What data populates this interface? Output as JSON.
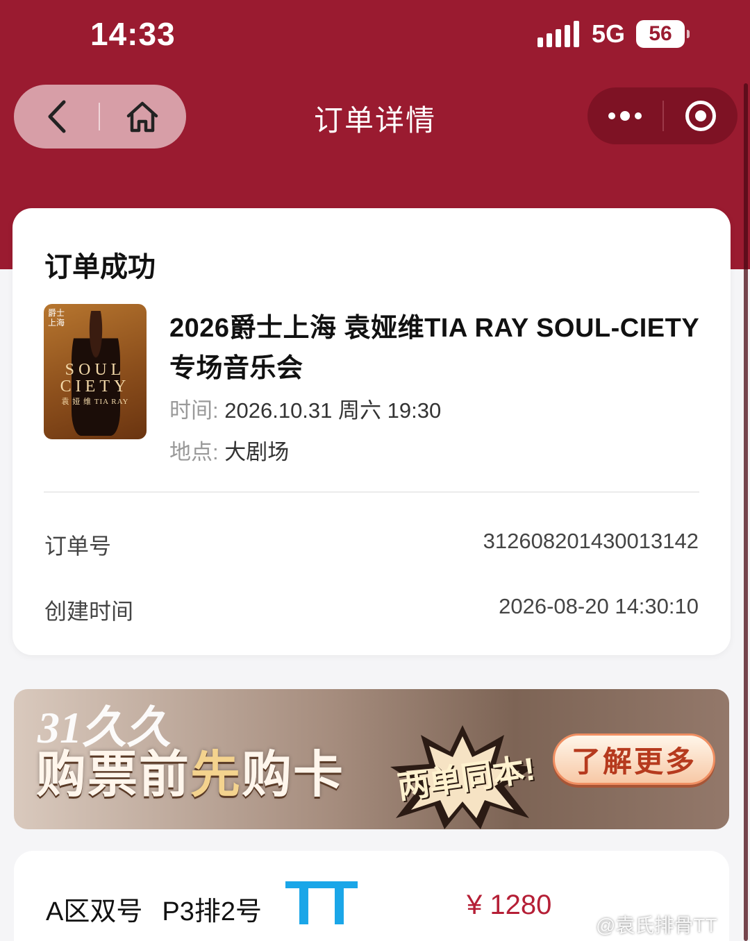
{
  "status_bar": {
    "time": "14:33",
    "network": "5G",
    "battery": "56"
  },
  "nav": {
    "title": "订单详情"
  },
  "order": {
    "status": "订单成功",
    "event_name": "2026爵士上海 袁娅维TIA RAY SOUL-CIETY专场音乐会",
    "time_label": "时间:",
    "time_value": "2026.10.31 周六 19:30",
    "place_label": "地点:",
    "place_value": "大剧场",
    "order_no_label": "订单号",
    "order_no_value": "312608201430013142",
    "created_label": "创建时间",
    "created_value": "2026-08-20 14:30:10"
  },
  "poster": {
    "line1": "SOUL",
    "line2": "CIETY",
    "line3": "袁 娅 维 TIA RAY",
    "logo": "爵士上海"
  },
  "banner": {
    "brand": "31久久",
    "slogan_a": "购票前",
    "slogan_b": "先",
    "slogan_c": "购卡",
    "burst": "两单同本!",
    "button": "了解更多"
  },
  "ticket": {
    "area": "A区双号",
    "seat": "P3排2号",
    "price": "¥ 1280"
  },
  "overlay": {
    "mark": "TT",
    "watermark": "@袁氏排骨TT"
  },
  "colors": {
    "header": "#9a1b30",
    "accent": "#b51f36"
  }
}
